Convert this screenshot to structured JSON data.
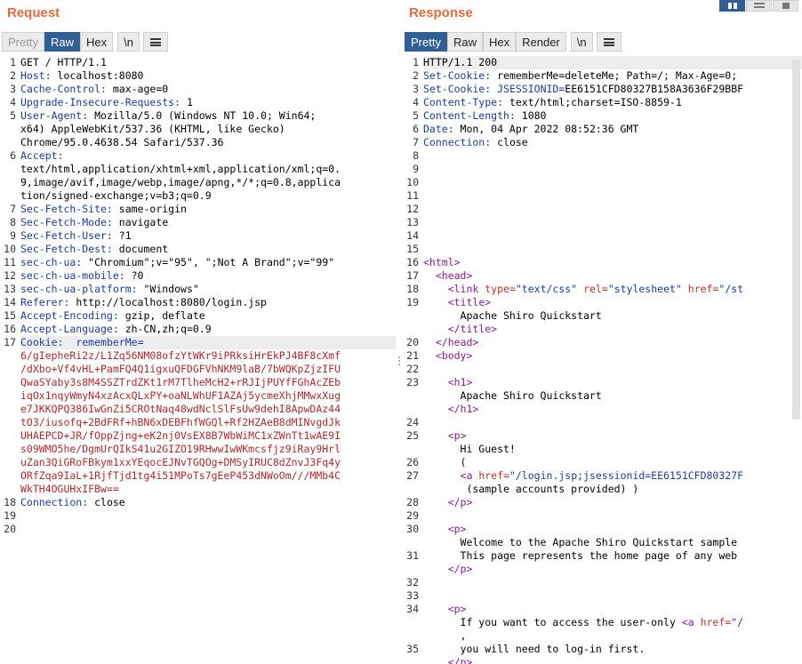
{
  "request": {
    "title": "Request",
    "tabs": [
      "Pretty",
      "Raw",
      "Hex",
      "\\n"
    ],
    "lines": [
      {
        "n": "1",
        "parts": [
          [
            "",
            "GET / HTTP/1.1"
          ]
        ]
      },
      {
        "n": "2",
        "parts": [
          [
            "k",
            "Host:"
          ],
          [
            "",
            " localhost:8080"
          ]
        ]
      },
      {
        "n": "3",
        "parts": [
          [
            "k",
            "Cache-Control:"
          ],
          [
            "",
            " max-age=0"
          ]
        ]
      },
      {
        "n": "4",
        "parts": [
          [
            "k",
            "Upgrade-Insecure-Requests:"
          ],
          [
            "",
            " 1"
          ]
        ]
      },
      {
        "n": "5",
        "parts": [
          [
            "k",
            "User-Agent:"
          ],
          [
            "",
            " Mozilla/5.0 (Windows NT 10.0; Win64;"
          ]
        ]
      },
      {
        "n": "",
        "parts": [
          [
            "",
            "x64) AppleWebKit/537.36 (KHTML, like Gecko)"
          ]
        ]
      },
      {
        "n": "",
        "parts": [
          [
            "",
            "Chrome/95.0.4638.54 Safari/537.36"
          ]
        ]
      },
      {
        "n": "6",
        "parts": [
          [
            "k",
            "Accept:"
          ]
        ]
      },
      {
        "n": "",
        "parts": [
          [
            "",
            "text/html,application/xhtml+xml,application/xml;q=0."
          ]
        ]
      },
      {
        "n": "",
        "parts": [
          [
            "",
            "9,image/avif,image/webp,image/apng,*/*;q=0.8,applica"
          ]
        ]
      },
      {
        "n": "",
        "parts": [
          [
            "",
            "tion/signed-exchange;v=b3;q=0.9"
          ]
        ]
      },
      {
        "n": "7",
        "parts": [
          [
            "k",
            "Sec-Fetch-Site:"
          ],
          [
            "",
            " same-origin"
          ]
        ]
      },
      {
        "n": "8",
        "parts": [
          [
            "k",
            "Sec-Fetch-Mode:"
          ],
          [
            "",
            " navigate"
          ]
        ]
      },
      {
        "n": "9",
        "parts": [
          [
            "k",
            "Sec-Fetch-User:"
          ],
          [
            "",
            " ?1"
          ]
        ]
      },
      {
        "n": "10",
        "parts": [
          [
            "k",
            "Sec-Fetch-Dest:"
          ],
          [
            "",
            " document"
          ]
        ]
      },
      {
        "n": "11",
        "parts": [
          [
            "k",
            "sec-ch-ua:"
          ],
          [
            "",
            " \"Chromium\";v=\"95\", \";Not A Brand\";v=\"99\""
          ]
        ]
      },
      {
        "n": "12",
        "parts": [
          [
            "k",
            "sec-ch-ua-mobile:"
          ],
          [
            "",
            " ?0"
          ]
        ]
      },
      {
        "n": "13",
        "parts": [
          [
            "k",
            "sec-ch-ua-platform:"
          ],
          [
            "",
            " \"Windows\""
          ]
        ]
      },
      {
        "n": "14",
        "parts": [
          [
            "k",
            "Referer:"
          ],
          [
            "",
            " http://localhost:8080/login.jsp"
          ]
        ]
      },
      {
        "n": "15",
        "parts": [
          [
            "k",
            "Accept-Encoding:"
          ],
          [
            "",
            " gzip, deflate"
          ]
        ]
      },
      {
        "n": "16",
        "parts": [
          [
            "k",
            "Accept-Language:"
          ],
          [
            "",
            " zh-CN,zh;q=0.9"
          ]
        ]
      },
      {
        "n": "17",
        "hl": true,
        "parts": [
          [
            "k",
            "Cookie:"
          ],
          [
            "",
            "  "
          ],
          [
            "k",
            "rememberMe="
          ]
        ]
      },
      {
        "n": "",
        "parts": [
          [
            "red",
            "6/gIepheRi2z/L1Zq56NM08ofzYtWKr9iPRksiHrEkPJ4BF8cXmf"
          ]
        ]
      },
      {
        "n": "",
        "parts": [
          [
            "red",
            "/dXbo+Vf4vHL+PamFQ4Q1igxuQFDGFVhNKM9laB/7bWQKpZjzIFU"
          ]
        ]
      },
      {
        "n": "",
        "parts": [
          [
            "red",
            "QwaSYaby3s8M4SSZTrdZKt1rM7TlheMcH2+rRJIjPUYfFGhAcZEb"
          ]
        ]
      },
      {
        "n": "",
        "parts": [
          [
            "red",
            "iqOx1nqyWmyN4xzAcxQLxPY+oaNLWhUF1AZAj5ycmeXhjMMwxXug"
          ]
        ]
      },
      {
        "n": "",
        "parts": [
          [
            "red",
            "e7JKKQPQ386IwGnZi5CROtNaq48wdNclSlFsUw9dehI8ApwDAz44"
          ]
        ]
      },
      {
        "n": "",
        "parts": [
          [
            "red",
            "tO3/iusofq+2BdFRf+hBN6xDEBFhfWGQl+Rf2HZAeB8dMINvgdJk"
          ]
        ]
      },
      {
        "n": "",
        "parts": [
          [
            "red",
            "UHAEPCD+JR/fOppZjng+eK2nj0VsEX8B7WbWiMC1xZWnTt1wAE9I"
          ]
        ]
      },
      {
        "n": "",
        "parts": [
          [
            "red",
            "s09WMO5he/DgmUrQIkS41u2GIZO19RHwwIwWKmcsfjz9iRay9Hrl"
          ]
        ]
      },
      {
        "n": "",
        "parts": [
          [
            "red",
            "uZan3QiGRoFBkym1xxYEqocEJNvTGQOg+DMSyIRUC8dZnvJ3Fq4y"
          ]
        ]
      },
      {
        "n": "",
        "parts": [
          [
            "red",
            "ORfZqa9IaL+1RjfTjd1tg4i51MPoTs7gEeP453dNWoOm///MMb4C"
          ]
        ]
      },
      {
        "n": "",
        "parts": [
          [
            "red",
            "WkTH4OGUHxIFBw=="
          ]
        ]
      },
      {
        "n": "18",
        "parts": [
          [
            "k",
            "Connection:"
          ],
          [
            "",
            " close"
          ]
        ]
      },
      {
        "n": "19",
        "parts": []
      },
      {
        "n": "20",
        "parts": []
      }
    ]
  },
  "response": {
    "title": "Response",
    "tabs": [
      "Pretty",
      "Raw",
      "Hex",
      "Render",
      "\\n"
    ],
    "lines": [
      {
        "n": "1",
        "hl": true,
        "parts": [
          [
            "",
            "HTTP/1.1 200"
          ]
        ]
      },
      {
        "n": "2",
        "parts": [
          [
            "k",
            "Set-Cookie:"
          ],
          [
            "",
            " rememberMe=deleteMe; Path=/; Max-Age=0;"
          ]
        ]
      },
      {
        "n": "3",
        "parts": [
          [
            "k",
            "Set-Cookie:"
          ],
          [
            "",
            " "
          ],
          [
            "k",
            "JSESSIONID="
          ],
          [
            "",
            "EE6151CFD80327B158A3636F29BBF"
          ]
        ]
      },
      {
        "n": "4",
        "parts": [
          [
            "k",
            "Content-Type:"
          ],
          [
            "",
            " text/html;charset=ISO-8859-1"
          ]
        ]
      },
      {
        "n": "5",
        "parts": [
          [
            "k",
            "Content-Length:"
          ],
          [
            "",
            " 1080"
          ]
        ]
      },
      {
        "n": "6",
        "parts": [
          [
            "k",
            "Date:"
          ],
          [
            "",
            " Mon, 04 Apr 2022 08:52:36 GMT"
          ]
        ]
      },
      {
        "n": "7",
        "parts": [
          [
            "k",
            "Connection:"
          ],
          [
            "",
            " close"
          ]
        ]
      },
      {
        "n": "8",
        "parts": []
      },
      {
        "n": "9",
        "parts": []
      },
      {
        "n": "10",
        "parts": []
      },
      {
        "n": "11",
        "parts": []
      },
      {
        "n": "12",
        "parts": []
      },
      {
        "n": "13",
        "parts": []
      },
      {
        "n": "14",
        "parts": []
      },
      {
        "n": "15",
        "parts": []
      },
      {
        "n": "16",
        "parts": [
          [
            "tag",
            "<html>"
          ]
        ]
      },
      {
        "n": "17",
        "parts": [
          [
            "",
            "  "
          ],
          [
            "tag",
            "<head>"
          ]
        ]
      },
      {
        "n": "18",
        "parts": [
          [
            "",
            "    "
          ],
          [
            "tag",
            "<link "
          ],
          [
            "attr",
            "type="
          ],
          [
            "str",
            "\"text/css\""
          ],
          [
            "",
            " "
          ],
          [
            "attr",
            "rel="
          ],
          [
            "str",
            "\"stylesheet\""
          ],
          [
            "",
            " "
          ],
          [
            "attr",
            "href="
          ],
          [
            "str",
            "\"/st"
          ]
        ]
      },
      {
        "n": "19",
        "parts": [
          [
            "",
            "    "
          ],
          [
            "tag",
            "<title>"
          ]
        ]
      },
      {
        "n": "",
        "parts": [
          [
            "",
            "      Apache Shiro Quickstart"
          ]
        ]
      },
      {
        "n": "",
        "parts": [
          [
            "",
            "    "
          ],
          [
            "tag",
            "</title>"
          ]
        ]
      },
      {
        "n": "20",
        "parts": [
          [
            "",
            "  "
          ],
          [
            "tag",
            "</head>"
          ]
        ]
      },
      {
        "n": "21",
        "parts": [
          [
            "",
            "  "
          ],
          [
            "tag",
            "<body>"
          ]
        ]
      },
      {
        "n": "22",
        "parts": []
      },
      {
        "n": "23",
        "parts": [
          [
            "",
            "    "
          ],
          [
            "tag",
            "<h1>"
          ]
        ]
      },
      {
        "n": "",
        "parts": [
          [
            "",
            "      Apache Shiro Quickstart"
          ]
        ]
      },
      {
        "n": "",
        "parts": [
          [
            "",
            "    "
          ],
          [
            "tag",
            "</h1>"
          ]
        ]
      },
      {
        "n": "24",
        "parts": []
      },
      {
        "n": "25",
        "parts": [
          [
            "",
            "    "
          ],
          [
            "tag",
            "<p>"
          ]
        ]
      },
      {
        "n": "",
        "parts": [
          [
            "",
            "      Hi Guest!"
          ]
        ]
      },
      {
        "n": "26",
        "parts": [
          [
            "",
            "      ("
          ]
        ]
      },
      {
        "n": "27",
        "parts": [
          [
            "",
            "      "
          ],
          [
            "tag",
            "<a "
          ],
          [
            "attr",
            "href="
          ],
          [
            "str",
            "\"/login.jsp;jsessionid=EE6151CFD80327F"
          ]
        ]
      },
      {
        "n": "",
        "parts": [
          [
            "",
            "       (sample accounts provided) )"
          ]
        ]
      },
      {
        "n": "28",
        "parts": [
          [
            "",
            "    "
          ],
          [
            "tag",
            "</p>"
          ]
        ]
      },
      {
        "n": "29",
        "parts": []
      },
      {
        "n": "30",
        "parts": [
          [
            "",
            "    "
          ],
          [
            "tag",
            "<p>"
          ]
        ]
      },
      {
        "n": "",
        "parts": [
          [
            "",
            "      Welcome to the Apache Shiro Quickstart sample"
          ]
        ]
      },
      {
        "n": "31",
        "parts": [
          [
            "",
            "      This page represents the home page of any web"
          ]
        ]
      },
      {
        "n": "",
        "parts": [
          [
            "",
            "    "
          ],
          [
            "tag",
            "</p>"
          ]
        ]
      },
      {
        "n": "32",
        "parts": []
      },
      {
        "n": "33",
        "parts": []
      },
      {
        "n": "34",
        "parts": [
          [
            "",
            "    "
          ],
          [
            "tag",
            "<p>"
          ]
        ]
      },
      {
        "n": "",
        "parts": [
          [
            "",
            "      If you want to access the user-only "
          ],
          [
            "tag",
            "<a "
          ],
          [
            "attr",
            "href="
          ],
          [
            "str",
            "\"/"
          ]
        ]
      },
      {
        "n": "",
        "parts": [
          [
            "",
            "      ,"
          ]
        ]
      },
      {
        "n": "35",
        "parts": [
          [
            "",
            "      you will need to log-in first."
          ]
        ]
      },
      {
        "n": "",
        "parts": [
          [
            "",
            "    "
          ],
          [
            "tag",
            "</p>"
          ]
        ]
      }
    ]
  }
}
